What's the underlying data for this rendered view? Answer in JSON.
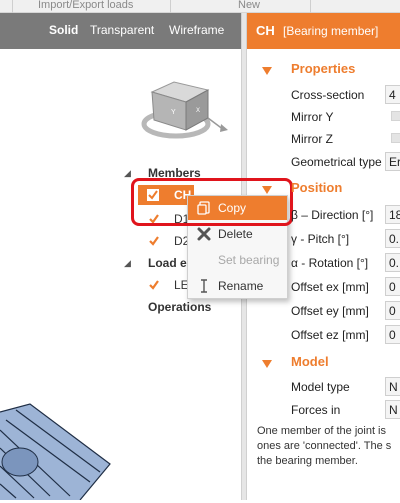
{
  "ribbon": {
    "left_label": "Import/Export loads",
    "right_label": "New"
  },
  "view_toolbar": {
    "solid": "Solid",
    "transparent": "Transparent",
    "wireframe": "Wireframe"
  },
  "properties_header": {
    "code": "CH",
    "title": "[Bearing member]"
  },
  "tree": {
    "members_label": "Members",
    "members": [
      {
        "label": "CH",
        "checked": true,
        "selected": true
      },
      {
        "label": "D1",
        "checked": true,
        "selected": false
      },
      {
        "label": "D2",
        "checked": true,
        "selected": false
      }
    ],
    "load_effects_label": "Load e",
    "load_effects": [
      {
        "label": "LE",
        "checked": true
      }
    ],
    "operations_label": "Operations"
  },
  "context_menu": {
    "items": [
      {
        "label": "Copy",
        "icon": "copy-icon",
        "highlighted": true,
        "enabled": true
      },
      {
        "label": "Delete",
        "icon": "delete-x-icon",
        "highlighted": false,
        "enabled": true
      },
      {
        "label": "Set bearing",
        "icon": "",
        "highlighted": false,
        "enabled": false
      },
      {
        "label": "Rename",
        "icon": "rename-cursor-icon",
        "highlighted": false,
        "enabled": true
      }
    ]
  },
  "properties": {
    "sections": [
      {
        "title": "Properties",
        "rows": [
          {
            "label": "Cross-section",
            "value": "4"
          },
          {
            "label": "Mirror Y",
            "value": ""
          },
          {
            "label": "Mirror Z",
            "value": ""
          },
          {
            "label": "Geometrical type",
            "value": "Er"
          }
        ]
      },
      {
        "title": "Position",
        "rows": [
          {
            "label": "β – Direction [°]",
            "value": "18"
          },
          {
            "label": "γ - Pitch [°]",
            "value": "0."
          },
          {
            "label": "α - Rotation [°]",
            "value": "0."
          },
          {
            "label": "Offset ex [mm]",
            "value": "0"
          },
          {
            "label": "Offset ey [mm]",
            "value": "0"
          },
          {
            "label": "Offset ez [mm]",
            "value": "0"
          }
        ]
      },
      {
        "title": "Model",
        "rows": [
          {
            "label": "Model type",
            "value": "N"
          },
          {
            "label": "Forces in",
            "value": "N"
          }
        ]
      }
    ]
  },
  "description": {
    "line1": "One member of the joint is",
    "line2": "ones are 'connected'. The s",
    "line3": "the bearing member."
  },
  "colors": {
    "accent": "#ee7d2e",
    "highlight_frame": "#e0141c",
    "toolbar": "#7a7a7a"
  }
}
